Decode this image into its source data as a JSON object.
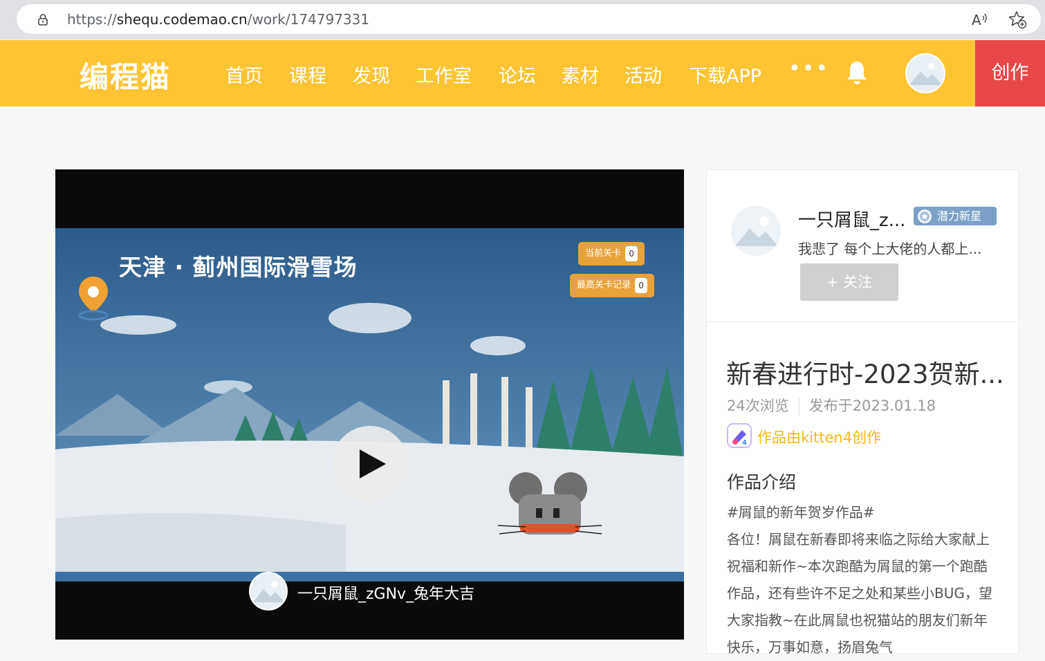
{
  "browser": {
    "url_prefix": "https://",
    "url_domain": "shequ.codemao.cn",
    "url_path": "/work/174797331"
  },
  "header": {
    "logo": "编程猫",
    "nav": [
      "首页",
      "课程",
      "发现",
      "工作室",
      "论坛",
      "素材",
      "活动",
      "下载APP"
    ],
    "more": "•••",
    "create_label": "创作"
  },
  "player": {
    "scene_title": "天津 · 蓟州国际滑雪场",
    "hud_current_label": "当前关卡",
    "hud_current_value": "0",
    "hud_best_label": "最高关卡记录",
    "hud_best_value": "0",
    "author_title": "一只屑鼠_zGNv_兔年大吉"
  },
  "author": {
    "name": "一只屑鼠_z...",
    "badge": "潜力新星",
    "bio": "我悲了 每个上大佬的人都上...",
    "follow_label": "+ 关注"
  },
  "work": {
    "title": "新春进行时-2023贺新...",
    "views": "24次浏览",
    "published": "发布于2023.01.18",
    "tool_text": "作品由kitten4创作",
    "intro_title": "作品介绍",
    "intro_body": "#屑鼠的新年贺岁作品#\n各位！屑鼠在新春即将来临之际给大家献上祝福和新作~本次跑酷为屑鼠的第一个跑酷作品，还有些许不足之处和某些小BUG，望大家指教~在此屑鼠也祝猫站的朋友们新年快乐，万事如意，扬眉兔气"
  },
  "colors": {
    "brand_yellow": "#fec433",
    "create_red": "#e84848",
    "badge_blue": "#7da0c9",
    "tool_gold": "#f5b81c"
  },
  "icons": {
    "lock": "lock-icon",
    "read_aloud": "read-aloud-icon",
    "favorite": "favorite-add-icon",
    "bell": "bell-icon",
    "play": "play-icon"
  }
}
